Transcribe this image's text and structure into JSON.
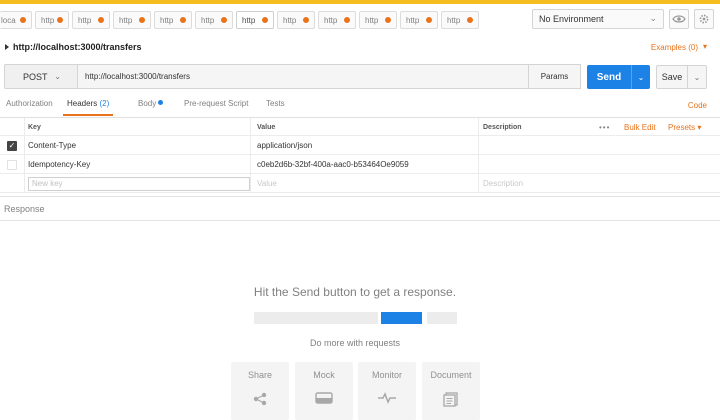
{
  "tabs": [
    {
      "label": "loca"
    },
    {
      "label": "http"
    },
    {
      "label": "http"
    },
    {
      "label": "http"
    },
    {
      "label": "http"
    },
    {
      "label": "http"
    },
    {
      "label": "http"
    },
    {
      "label": "http"
    },
    {
      "label": "http"
    },
    {
      "label": "http"
    },
    {
      "label": "http"
    },
    {
      "label": "http"
    }
  ],
  "environment": {
    "selected": "No Environment"
  },
  "request": {
    "title": "http://localhost:3000/transfers",
    "examples_label": "Examples (0)",
    "method": "POST",
    "url": "http://localhost:3000/transfers",
    "params_label": "Params",
    "send_label": "Send",
    "save_label": "Save"
  },
  "request_tabs": {
    "authorization": "Authorization",
    "headers": "Headers",
    "headers_count": "(2)",
    "body": "Body",
    "prerequest": "Pre-request Script",
    "tests": "Tests",
    "code": "Code"
  },
  "headers_table": {
    "columns": {
      "key": "Key",
      "value": "Value",
      "description": "Description"
    },
    "bulk_edit": "Bulk Edit",
    "presets": "Presets",
    "rows": [
      {
        "checked": true,
        "key": "Content-Type",
        "value": "application/json",
        "description": ""
      },
      {
        "checked": false,
        "key": "Idempotency-Key",
        "value": "c0eb2d6b-32bf-400a-aac0-b53464Oe9059",
        "description": ""
      }
    ],
    "new_row": {
      "key_placeholder": "New key",
      "value_placeholder": "Value",
      "description_placeholder": "Description"
    }
  },
  "response": {
    "label": "Response",
    "empty_title": "Hit the Send button to get a response.",
    "more_text": "Do more with requests",
    "actions": [
      {
        "label": "Share",
        "icon": "share-icon"
      },
      {
        "label": "Mock",
        "icon": "mock-icon"
      },
      {
        "label": "Monitor",
        "icon": "monitor-icon"
      },
      {
        "label": "Document",
        "icon": "document-icon"
      }
    ]
  },
  "colors": {
    "accent": "#e8731b",
    "primary": "#1d82e6",
    "topbar": "#f6bd20"
  }
}
